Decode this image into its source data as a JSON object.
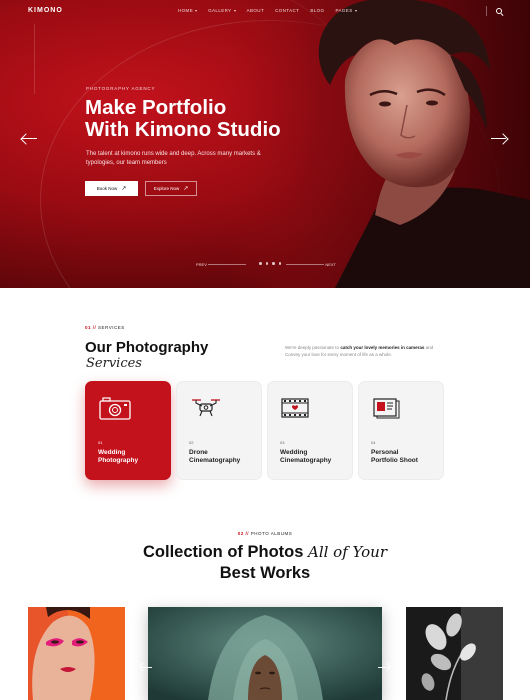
{
  "nav": {
    "logo": "KIMONO",
    "items": [
      {
        "label": "Home",
        "has_dropdown": true
      },
      {
        "label": "Gallery",
        "has_dropdown": true
      },
      {
        "label": "About",
        "has_dropdown": false
      },
      {
        "label": "Contact",
        "has_dropdown": false
      },
      {
        "label": "Blog",
        "has_dropdown": false
      },
      {
        "label": "Pages",
        "has_dropdown": true
      }
    ],
    "search_icon": "search-icon"
  },
  "hero": {
    "eyebrow": "Photography Agency",
    "title_line1": "Make Portfolio",
    "title_line2": "With Kimono Studio",
    "description": "The talent at kimono runs wide and deep. Across many markets & typologies, our team members",
    "primary_button": "Book Now",
    "secondary_button": "Explore Now",
    "button_arrow": "↗",
    "prev_label": "PREV",
    "next_label": "NEXT",
    "slide_count": 4,
    "colors": {
      "accent": "#c3121c",
      "deep": "#5e060a"
    }
  },
  "services": {
    "eyebrow_num": "01 //",
    "eyebrow_label": "Services",
    "title": "Our Photography",
    "title_italic": "Services",
    "desc_pre": "We're deeply passionate to ",
    "desc_bold": "catch your lovely memories in cameras",
    "desc_post": " and Convey your love for every moment of life as a whole.",
    "cards": [
      {
        "num": "01",
        "line1": "Wedding",
        "line2": "Photography",
        "icon": "camera-icon",
        "active": true
      },
      {
        "num": "02",
        "line1": "Drone",
        "line2": "Cinematography",
        "icon": "drone-icon",
        "active": false
      },
      {
        "num": "03",
        "line1": "Wedding",
        "line2": "Cinematography",
        "icon": "film-strip-icon",
        "active": false
      },
      {
        "num": "04",
        "line1": "Personal",
        "line2": "Portfolio Shoot",
        "icon": "portfolio-icon",
        "active": false
      }
    ]
  },
  "albums": {
    "eyebrow_num": "02 //",
    "eyebrow_label": "Photo Albums",
    "title_prefix": "Collection of Photos ",
    "title_italic": "All of Your",
    "title_line2": "Best Works"
  }
}
